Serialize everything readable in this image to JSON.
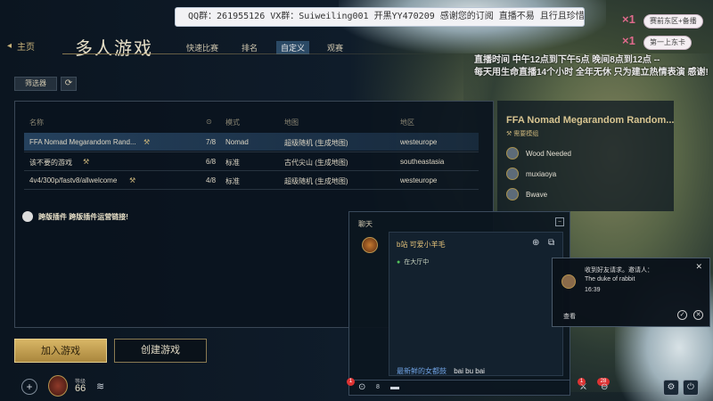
{
  "overlay": {
    "qq_banner": "QQ群：261955126 VX群：Suiweiling001 开黑YY470209 感谢您的订阅 直播不易 且行且珍惜 ♥",
    "pill1": "赛前东区+备播",
    "pill2": "第一上东卡",
    "x1a": "×1",
    "x1b": "×1",
    "stream_line1": "直播时间 中午12点到下午5点 晚间8点到12点 --",
    "stream_line2": "每天用生命直播14个小时 全年无休 只为建立热情表演 感谢!"
  },
  "nav": {
    "back_label": "主页",
    "title": "多人游戏",
    "tabs": [
      "快速比赛",
      "排名",
      "自定义",
      "观赛"
    ],
    "active_tab": "自定义"
  },
  "toolbar": {
    "filter_label": "筛选器"
  },
  "list": {
    "headers": [
      "名称",
      "",
      "模式",
      "地图",
      "地区"
    ],
    "rows": [
      [
        "FFA Nomad Megarandom Rand...",
        "7/8",
        "Nomad",
        "超级随机 (生成地图)",
        "westeurope"
      ],
      [
        "该不要的游戏",
        "6/8",
        "标准",
        "古代尖山 (生成地图)",
        "southeastasia"
      ],
      [
        "4v4/300p/fastv8/allwelcome",
        "4/8",
        "标准",
        "超级随机 (生成地图)",
        "westeurope"
      ]
    ],
    "notice": "跨版插件 跨版插件运营链接!"
  },
  "detail": {
    "title": "FFA Nomad Megarandom Random...",
    "subtitle": "需要模组",
    "players": [
      "Wood Needed",
      "muxiaoya",
      "Bwave"
    ]
  },
  "buttons": {
    "join": "加入游戏",
    "create": "创建游戏"
  },
  "profile": {
    "level_label": "等级",
    "level": "66"
  },
  "chat": {
    "title": "聊天",
    "user": "b站 可爱小羊毛",
    "status": "在大厅中",
    "msg_name": "最新鲜的女都鼓",
    "msg_text": "bai bu bai",
    "online_count": "8",
    "badge1": "1",
    "badge2": "1",
    "badge3": "28"
  },
  "friend": {
    "line1": "收到好友请求。邀请人：",
    "line2": "The duke of rabbit",
    "line3": "16:39",
    "view": "查看"
  }
}
